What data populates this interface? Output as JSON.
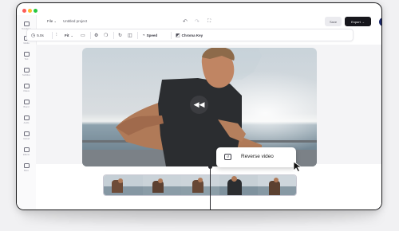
{
  "header": {
    "file_menu": "File",
    "project_name": "Untitled project",
    "save_label": "Save",
    "export_label": "Export",
    "export_arrow": "→"
  },
  "sidebar": {
    "items": [
      {
        "label": "Templates",
        "icon": "template-icon"
      },
      {
        "label": "Media",
        "icon": "folder-icon"
      },
      {
        "label": "Text",
        "icon": "text-icon"
      },
      {
        "label": "Subtitles",
        "icon": "subtitles-icon"
      },
      {
        "label": "Videos",
        "icon": "video-icon"
      },
      {
        "label": "Brand",
        "icon": "brand-icon"
      },
      {
        "label": "Audio",
        "icon": "music-icon"
      },
      {
        "label": "Upload",
        "icon": "upload-icon"
      },
      {
        "label": "Effects",
        "icon": "effects-icon"
      },
      {
        "label": "More",
        "icon": "more-icon"
      }
    ]
  },
  "toolbar": {
    "duration": "5.0s",
    "fit": "Fit",
    "speed_label": "Speed",
    "chroma_label": "Chroma Key"
  },
  "popup": {
    "reverse_label": "Reverse video"
  }
}
